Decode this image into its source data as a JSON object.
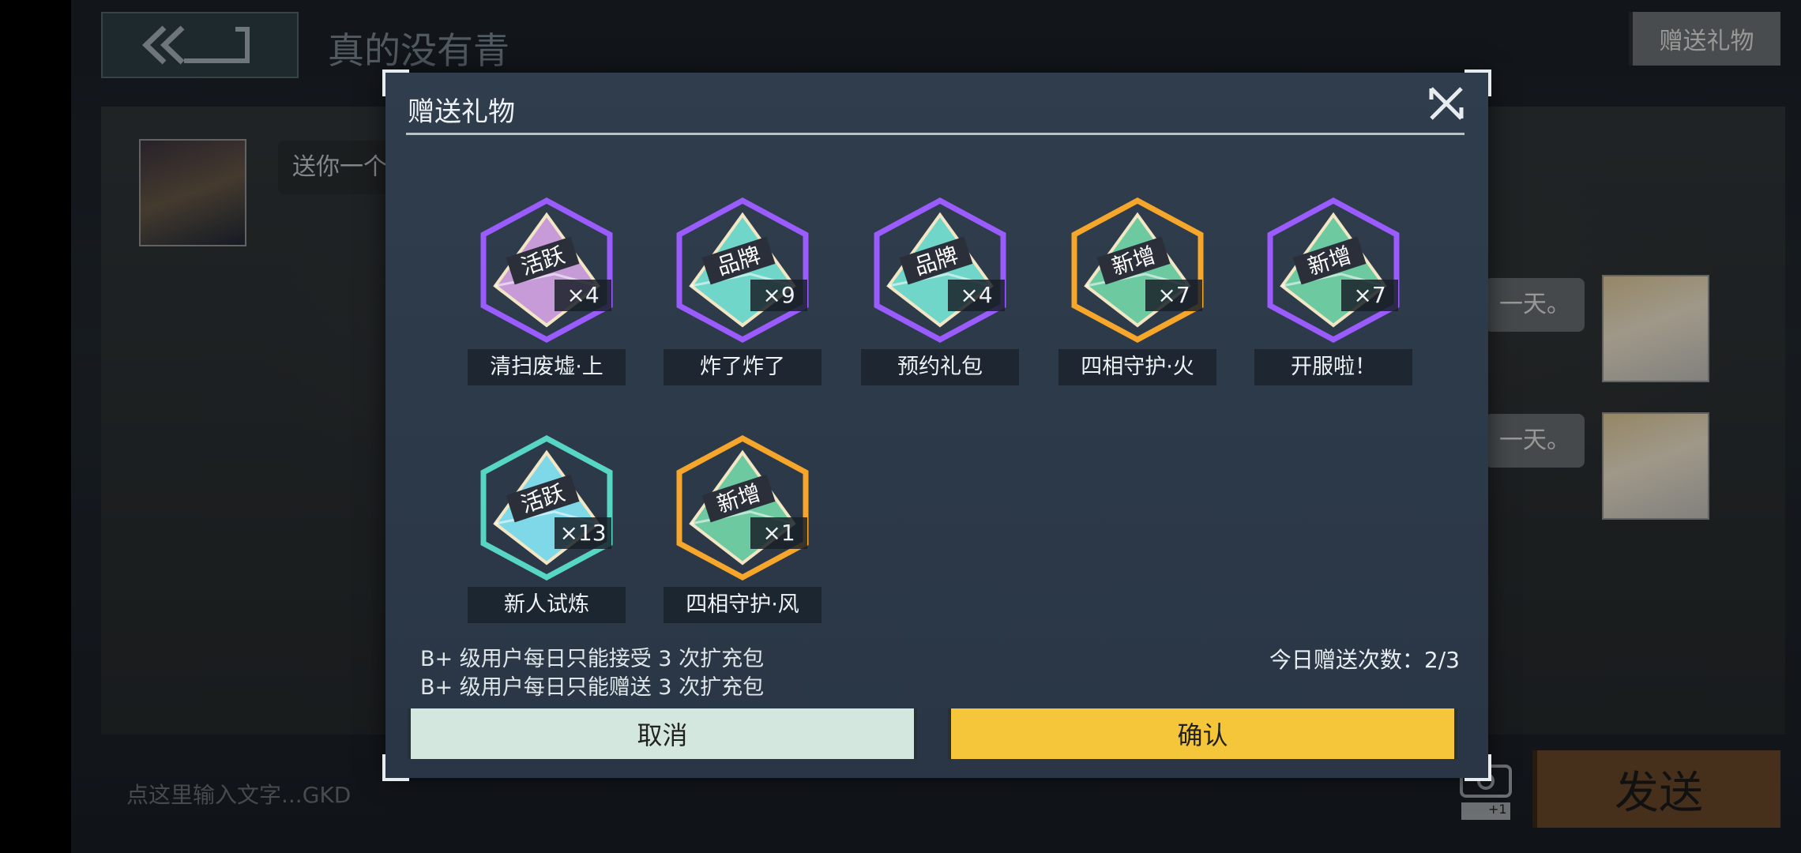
{
  "chat": {
    "title": "真的没有青",
    "gift_button": "赠送礼物",
    "left_message": "送你一个",
    "right_messages": [
      "一天。",
      "一天。"
    ],
    "input_placeholder": "点这里输入文字...GKD",
    "send_button": "发送",
    "gamepad_badge": "+1"
  },
  "modal": {
    "title": "赠送礼物",
    "gifts": [
      {
        "name": "清扫废墟·上",
        "count": "×4",
        "tag": "活跃",
        "frame_color": "#9a5cff",
        "gem_color": "#c79bd8"
      },
      {
        "name": "炸了炸了",
        "count": "×9",
        "tag": "品牌",
        "frame_color": "#9a5cff",
        "gem_color": "#6fd6c9"
      },
      {
        "name": "预约礼包",
        "count": "×4",
        "tag": "品牌",
        "frame_color": "#9a5cff",
        "gem_color": "#6fd6c9"
      },
      {
        "name": "四相守护·火",
        "count": "×7",
        "tag": "新增",
        "frame_color": "#f6a62a",
        "gem_color": "#6cc9a0"
      },
      {
        "name": "开服啦！",
        "count": "×7",
        "tag": "新增",
        "frame_color": "#9a5cff",
        "gem_color": "#6cc9a0"
      },
      {
        "name": "新人试炼",
        "count": "×13",
        "tag": "活跃",
        "frame_color": "#57d6c6",
        "gem_color": "#7fd8e8"
      },
      {
        "name": "四相守护·风",
        "count": "×1",
        "tag": "新增",
        "frame_color": "#f6a62a",
        "gem_color": "#6cc9a0"
      }
    ],
    "rules": [
      "B+ 级用户每日只能接受 3 次扩充包",
      "B+ 级用户每日只能赠送 3 次扩充包"
    ],
    "daily_count_label": "今日赠送次数：2/3",
    "cancel_label": "取消",
    "confirm_label": "确认"
  }
}
